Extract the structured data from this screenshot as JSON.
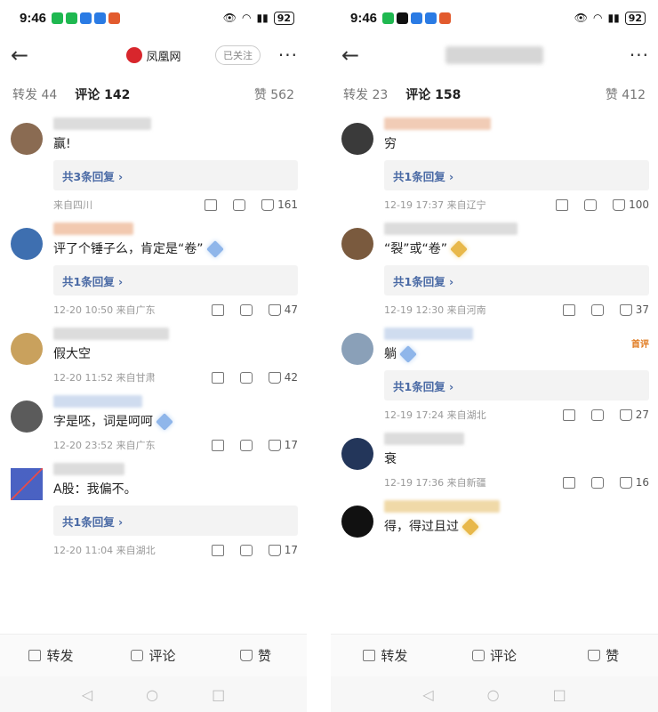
{
  "left": {
    "status": {
      "time": "9:46",
      "battery": "92"
    },
    "header": {
      "title": "凤凰网",
      "follow_label": "已关注",
      "more": "···",
      "back": "←"
    },
    "tabs": {
      "repost": "转发",
      "repost_count": "44",
      "comment": "评论",
      "comment_count": "142",
      "like_label": "赞",
      "like_count": "562"
    },
    "comments": [
      {
        "text": "赢!",
        "replies": "共3条回复 ›",
        "date": "",
        "location": "来自四川",
        "likes": "161",
        "avatar_color": "#8a6b52"
      },
      {
        "text": "评了个锤子么，肯定是“卷”",
        "replies": "共1条回复 ›",
        "date": "12-20 10:50",
        "location": "来自广东",
        "likes": "47",
        "avatar_color": "#3e6fb0"
      },
      {
        "text": "假大空",
        "replies": "",
        "date": "12-20 11:52",
        "location": "来自甘肃",
        "likes": "42",
        "avatar_color": "#c9a15d"
      },
      {
        "text": "字是呸，词是呵呵",
        "replies": "",
        "date": "12-20 23:52",
        "location": "来自广东",
        "likes": "17",
        "avatar_color": "#5b5b5b"
      },
      {
        "text": "A股：我偏不。",
        "replies": "共1条回复 ›",
        "date": "12-20 11:04",
        "location": "来自湖北",
        "likes": "17",
        "avatar_color": "#2a46b8"
      }
    ],
    "bottom": {
      "repost": "转发",
      "comment": "评论",
      "like": "赞"
    }
  },
  "right": {
    "status": {
      "time": "9:46",
      "battery": "92"
    },
    "header": {
      "more": "···",
      "back": "←"
    },
    "tabs": {
      "repost": "转发",
      "repost_count": "23",
      "comment": "评论",
      "comment_count": "158",
      "like_label": "赞",
      "like_count": "412"
    },
    "comments": [
      {
        "text": "穷",
        "replies": "共1条回复 ›",
        "date": "12-19 17:37",
        "location": "来自辽宁",
        "likes": "100",
        "avatar_color": "#3a3a3a",
        "hot": ""
      },
      {
        "text": "“裂”或“卷”",
        "replies": "共1条回复 ›",
        "date": "12-19 12:30",
        "location": "来自河南",
        "likes": "37",
        "avatar_color": "#7a5a3e",
        "hot": ""
      },
      {
        "text": "躺",
        "replies": "共1条回复 ›",
        "date": "12-19 17:24",
        "location": "来自湖北",
        "likes": "27",
        "avatar_color": "#8aa0b8",
        "hot": "首评"
      },
      {
        "text": "衰",
        "replies": "",
        "date": "12-19 17:36",
        "location": "来自新疆",
        "likes": "16",
        "avatar_color": "#23365a",
        "hot": ""
      },
      {
        "text": "得，得过且过",
        "replies": "",
        "date": "",
        "location": "",
        "likes": "",
        "avatar_color": "#111111",
        "hot": ""
      }
    ],
    "bottom": {
      "repost": "转发",
      "comment": "评论",
      "like": "赞"
    }
  },
  "nav": {
    "back": "◁",
    "home": "○",
    "recent": "□"
  }
}
